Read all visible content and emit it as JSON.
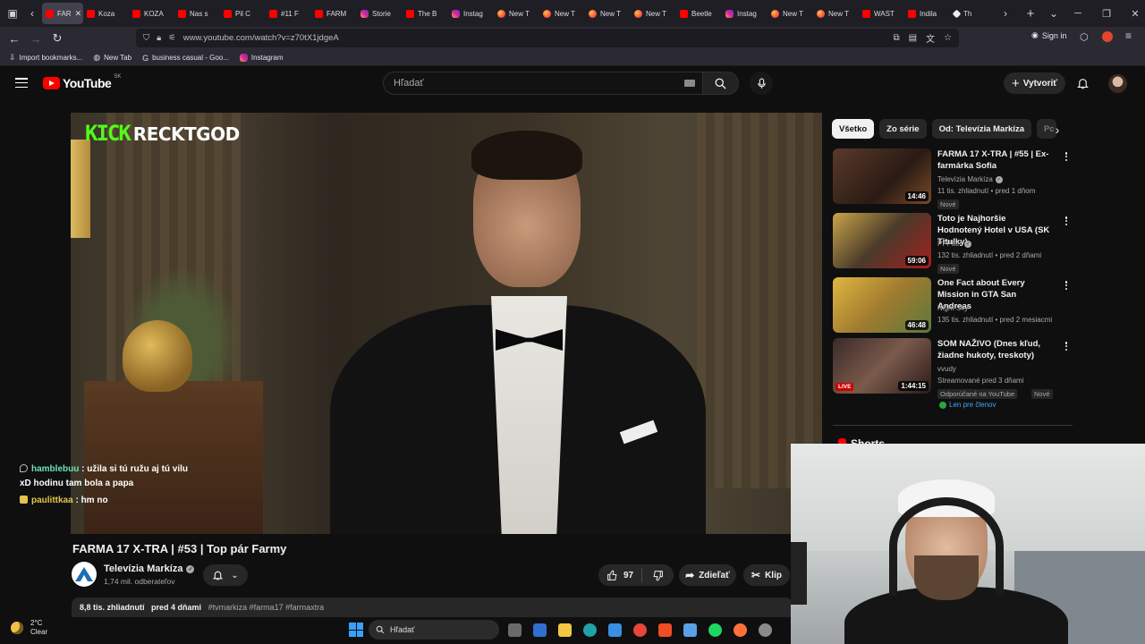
{
  "browser": {
    "tabs": [
      {
        "label": "FAR",
        "favicon": "youtube-icon",
        "active": true
      },
      {
        "label": "Koza",
        "favicon": "youtube-icon"
      },
      {
        "label": "KOZA",
        "favicon": "youtube-icon"
      },
      {
        "label": "Nas s",
        "favicon": "youtube-icon"
      },
      {
        "label": "Pil C",
        "favicon": "youtube-icon"
      },
      {
        "label": "#11 F",
        "favicon": "youtube-icon"
      },
      {
        "label": "FARM",
        "favicon": "youtube-icon"
      },
      {
        "label": "Storie",
        "favicon": "instagram-icon"
      },
      {
        "label": "The B",
        "favicon": "youtube-icon"
      },
      {
        "label": "Instag",
        "favicon": "instagram-icon"
      },
      {
        "label": "New T",
        "favicon": "firefox-icon"
      },
      {
        "label": "New T",
        "favicon": "firefox-icon"
      },
      {
        "label": "New T",
        "favicon": "firefox-icon"
      },
      {
        "label": "New T",
        "favicon": "firefox-icon"
      },
      {
        "label": "Beetle",
        "favicon": "youtube-icon"
      },
      {
        "label": "Instag",
        "favicon": "instagram-icon"
      },
      {
        "label": "New T",
        "favicon": "firefox-icon"
      },
      {
        "label": "New T",
        "favicon": "firefox-icon"
      },
      {
        "label": "WAST",
        "favicon": "youtube-icon"
      },
      {
        "label": "Indila",
        "favicon": "youtube-icon"
      },
      {
        "label": "Th",
        "favicon": "diamond-icon"
      }
    ],
    "url": "www.youtube.com/watch?v=z70tX1jdgeA",
    "signin_label": "Sign in",
    "bookmarks": [
      {
        "label": "Import bookmarks...",
        "icon": "import-icon"
      },
      {
        "label": "New Tab",
        "icon": "globe-icon"
      },
      {
        "label": "business casual - Goo...",
        "icon": "google-icon"
      },
      {
        "label": "Instagram",
        "icon": "instagram-icon"
      }
    ]
  },
  "youtube": {
    "logo_text": "YouTube",
    "country_code": "SK",
    "search_placeholder": "Hľadať",
    "create_label": "Vytvoriť",
    "overlay_brand": "KICK",
    "overlay_channel": "RECKTGOD",
    "chat": [
      {
        "user": "hamblebuu",
        "text": " : užila si tú ružu aj tú vilu",
        "cont": "xD hodinu tam bola a papa",
        "color": "#6fe0b4"
      },
      {
        "user": "paulittkaa",
        "text": " : hm no",
        "color": "#e5c44b"
      }
    ],
    "video_title": "FARMA 17 X-TRA | #53 | Top pár Farmy",
    "channel_name": "Televízia Markíza",
    "subscribers": "1,74 mil. odberateľov",
    "likes": "97",
    "share_label": "Zdieľať",
    "clip_label": "Klip",
    "description": {
      "views": "8,8 tis. zhliadnutí",
      "date": "pred 4 dňami",
      "tags": "#tvmarkiza #farma17 #farmaxtra"
    },
    "chips": [
      "Všetko",
      "Zo série",
      "Od: Televízia Markíza",
      "Pc"
    ],
    "recommendations": [
      {
        "title": "FARMA 17 X-TRA | #55 | Ex-farmárka Sofia",
        "channel": "Televízia Markíza",
        "verified": true,
        "meta": "11 tis. zhliadnutí • pred 1 dňom",
        "badge": "Nové",
        "duration": "14:46"
      },
      {
        "title": "Toto je Najhoršie Hodnotený Hotel v USA (SK Titulky)",
        "channel": "PPPiter",
        "verified": true,
        "meta": "132 tis. zhliadnutí • pred 2 dňami",
        "badge": "Nové",
        "duration": "59:06"
      },
      {
        "title": "One Fact about Every Mission in GTA San Andreas",
        "channel": "Night Sky",
        "verified": false,
        "meta": "135 tis. zhliadnutí • pred 2 mesiacmi",
        "badge": "",
        "duration": "46:48"
      },
      {
        "title": "SOM NAŽIVO (Dnes kľud, žiadne hukoty, treskoty)",
        "channel": "vvudy",
        "verified": false,
        "meta": "Streamované pred 3 dňami",
        "badge": "Odporúčané na YouTube",
        "badge2": "Nové",
        "duration": "1:44:15",
        "live_label": "LIVE",
        "member_label": "Len pre členov"
      }
    ],
    "shorts_label": "Shorts"
  },
  "taskbar": {
    "temperature": "2°C",
    "condition": "Clear",
    "search_label": "Hľadať",
    "apps": [
      "files-icon",
      "store-icon",
      "explorer-icon",
      "edge-icon",
      "photos-icon",
      "chrome-icon",
      "brave-icon",
      "notepad-icon",
      "spotify-icon",
      "firefox-icon",
      "settings-icon"
    ]
  },
  "colors": {
    "accent": "#ff0000",
    "kick_green": "#53fc18",
    "link": "#3ea6ff",
    "background": "#0f0f0f"
  }
}
